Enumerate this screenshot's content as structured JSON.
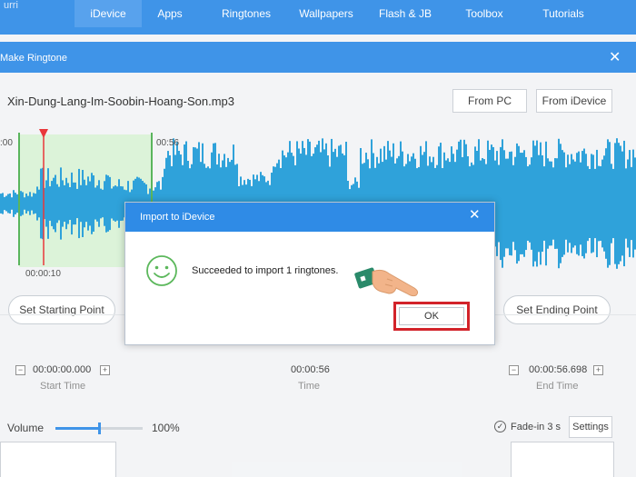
{
  "nav": {
    "brand": "urri",
    "tabs": [
      {
        "label": "iDevice",
        "active": true
      },
      {
        "label": "Apps",
        "active": false
      },
      {
        "label": "Ringtones",
        "active": false
      },
      {
        "label": "Wallpapers",
        "active": false
      },
      {
        "label": "Flash & JB",
        "active": false
      },
      {
        "label": "Toolbox",
        "active": false
      },
      {
        "label": "Tutorials",
        "active": false
      }
    ]
  },
  "panel": {
    "title": "Make Ringtone",
    "close_icon": "close-icon",
    "filename": "Xin-Dung-Lang-Im-Soobin-Hoang-Son.mp3",
    "from_pc": "From PC",
    "from_idevice": "From iDevice"
  },
  "waveform": {
    "label_left": ":00",
    "label_mark": "00:56",
    "label_playhead": "00:00:10",
    "selection_color": "#d9f2d6",
    "wave_color": "#1e9bd7",
    "marker_color": "#e8262a"
  },
  "controls": {
    "set_start": "Set Starting Point",
    "set_end": "Set Ending Point",
    "start_time": "00:00:00.000",
    "start_caption": "Start Time",
    "time_value": "00:00:56",
    "time_caption": "Time",
    "end_time": "00:00:56.698",
    "end_caption": "End Time",
    "minus": "−",
    "plus": "+"
  },
  "bottom": {
    "volume_label": "Volume",
    "volume_value": "100%",
    "volume_level": 0.5,
    "fade_label": "Fade-in 3 s",
    "settings_label": "Settings"
  },
  "dialog": {
    "title": "Import to iDevice",
    "message": "Succeeded to import 1 ringtones.",
    "ok": "OK",
    "smiley_icon": "smiley-icon",
    "hand_icon": "pointing-hand-icon"
  }
}
